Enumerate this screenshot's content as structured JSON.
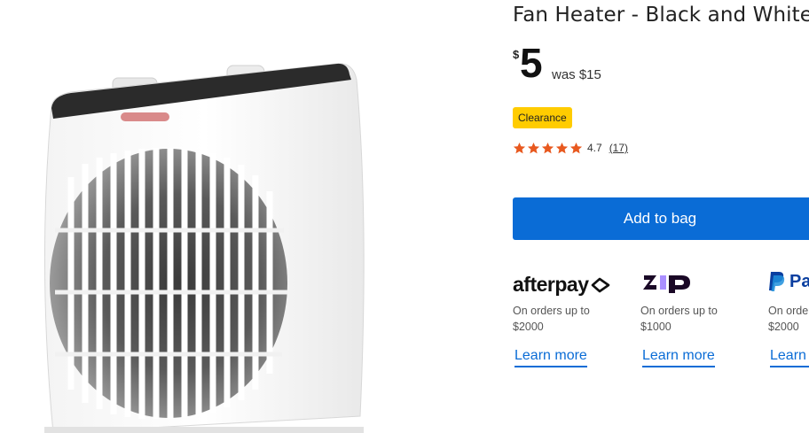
{
  "product": {
    "title": "Fan Heater - Black and White",
    "currency_symbol": "$",
    "price": "5",
    "was_price": "was $15",
    "badge": "Clearance",
    "rating": {
      "stars": 5,
      "value": "4.7",
      "count": "(17)"
    },
    "add_to_bag_label": "Add to bag",
    "image_alt": "Fan Heater - Black and White"
  },
  "payment_options": [
    {
      "logo_text": "afterpay",
      "description_line1": "On orders up to",
      "description_line2": "$2000",
      "learn_more": "Learn more"
    },
    {
      "logo_text": "zip",
      "description_line1": "On orders up to",
      "description_line2": "$1000",
      "learn_more": "Learn more"
    },
    {
      "logo_text": "PayPal",
      "description_line1": "On orders up to",
      "description_line2": "$2000",
      "learn_more": "Learn more"
    }
  ],
  "colors": {
    "accent_blue": "#0a6cd6",
    "badge_yellow": "#ffcc00",
    "star_orange": "#e8591f",
    "zip_purple": "#aa8fff"
  }
}
